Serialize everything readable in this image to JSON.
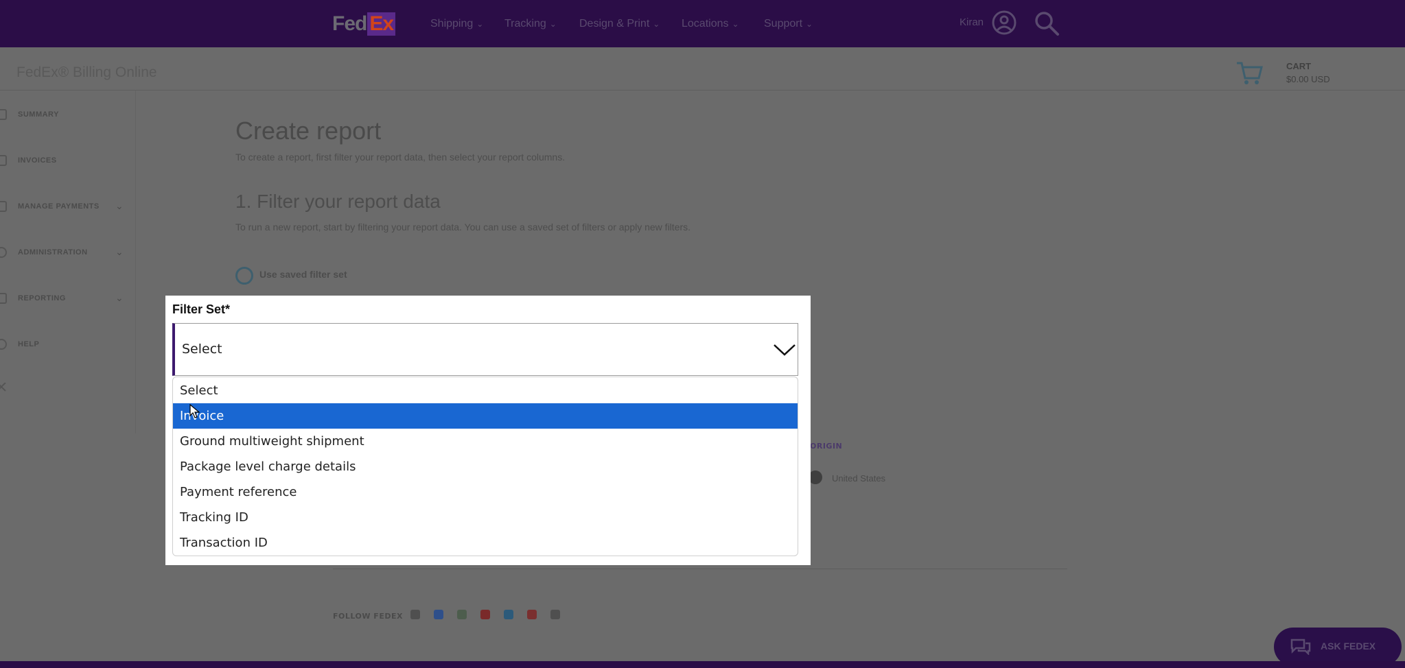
{
  "topnav": {
    "logo_fed": "Fed",
    "logo_ex": "Ex",
    "items": [
      {
        "label": "Shipping"
      },
      {
        "label": "Tracking"
      },
      {
        "label": "Design & Print"
      },
      {
        "label": "Locations"
      },
      {
        "label": "Support"
      }
    ],
    "user_name": "Kiran"
  },
  "header": {
    "app_title": "FedEx® Billing Online",
    "cart_label": "CART",
    "cart_amount": "$0.00 USD"
  },
  "sidebar": {
    "items": [
      {
        "label": "SUMMARY",
        "has_chevron": false
      },
      {
        "label": "INVOICES",
        "has_chevron": false
      },
      {
        "label": "MANAGE PAYMENTS",
        "has_chevron": true
      },
      {
        "label": "ADMINISTRATION",
        "has_chevron": true
      },
      {
        "label": "REPORTING",
        "has_chevron": true
      },
      {
        "label": "HELP",
        "has_chevron": false
      }
    ]
  },
  "main": {
    "title": "Create report",
    "subtitle": "To create a report, first filter your report data, then select your report columns.",
    "section_title": "1. Filter your report data",
    "section_desc": "To run a new report, start by filtering your report data. You can use a saved set of filters or apply new filters.",
    "radio_label": "Use saved filter set"
  },
  "background": {
    "column_label": "ORIGIN",
    "country": "United States",
    "follow_label": "FOLLOW FEDEX",
    "ask_label": "ASK FEDEX"
  },
  "modal": {
    "filter_label": "Filter Set*",
    "select_value": "Select",
    "options": [
      {
        "label": "Select",
        "selected": false
      },
      {
        "label": "Invoice",
        "selected": true
      },
      {
        "label": "Ground multiweight shipment",
        "selected": false
      },
      {
        "label": "Package level charge details",
        "selected": false
      },
      {
        "label": "Payment reference",
        "selected": false
      },
      {
        "label": "Tracking ID",
        "selected": false
      },
      {
        "label": "Transaction ID",
        "selected": false
      }
    ]
  },
  "colors": {
    "brand_purple": "#2b0d47",
    "brand_orange": "#d2441a",
    "highlight_blue": "#1967d2",
    "select_accent": "#3d1a6e"
  }
}
